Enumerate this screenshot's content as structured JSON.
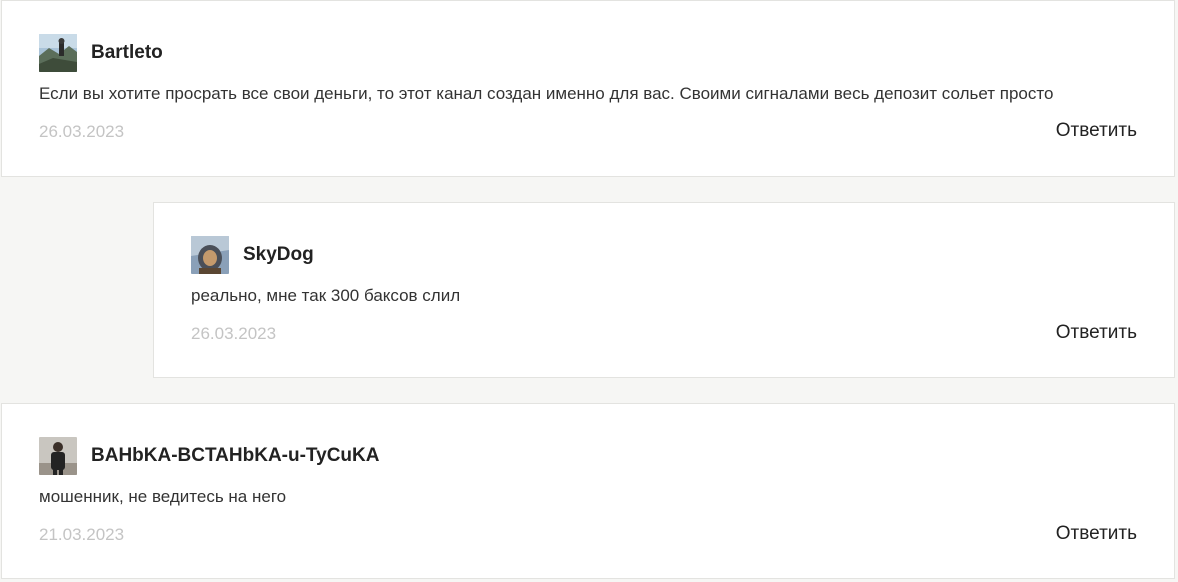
{
  "comments": [
    {
      "author": "Bartleto",
      "avatar_icon": "user-photo-mountain",
      "text": "Если вы хотите просрать все свои деньги, то этот канал создан именно для вас. Своими сигналами весь депозит сольет просто",
      "date": "26.03.2023",
      "reply_label": "Ответить"
    },
    {
      "author": "SkyDog",
      "avatar_icon": "user-photo-helmet",
      "text": "реально, мне так 300 баксов слил",
      "date": "26.03.2023",
      "reply_label": "Ответить"
    },
    {
      "author": "BAHbKA-BCTAHbKA-u-TyCuKA",
      "avatar_icon": "user-photo-person",
      "text": "мошенник, не ведитесь на него",
      "date": "21.03.2023",
      "reply_label": "Ответить"
    }
  ],
  "colors": {
    "page_background": "#f6f6f4",
    "card_background": "#ffffff",
    "date_text": "#c4c4c4"
  }
}
